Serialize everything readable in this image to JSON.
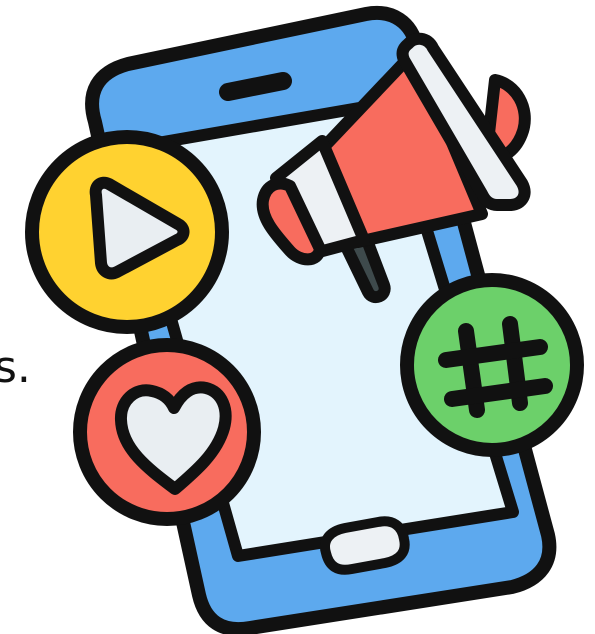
{
  "edge_text": "s.",
  "illustration": {
    "subject": "smartphone-social-media-marketing",
    "colors": {
      "outline": "#111111",
      "phone_body": "#5DA9EE",
      "screen": "#E3F4FD",
      "megaphone": "#F86C5E",
      "megaphone_tip": "#EDF1F4",
      "megaphone_handle": "#3E4A4C",
      "play_badge": "#FFD230",
      "play_symbol": "#E9EEF2",
      "heart_badge": "#F86C5E",
      "heart_symbol": "#E9EEF2",
      "hashtag_badge": "#6CD06A"
    },
    "icons": [
      "phone-icon",
      "megaphone-icon",
      "play-icon",
      "heart-icon",
      "hashtag-icon"
    ]
  }
}
